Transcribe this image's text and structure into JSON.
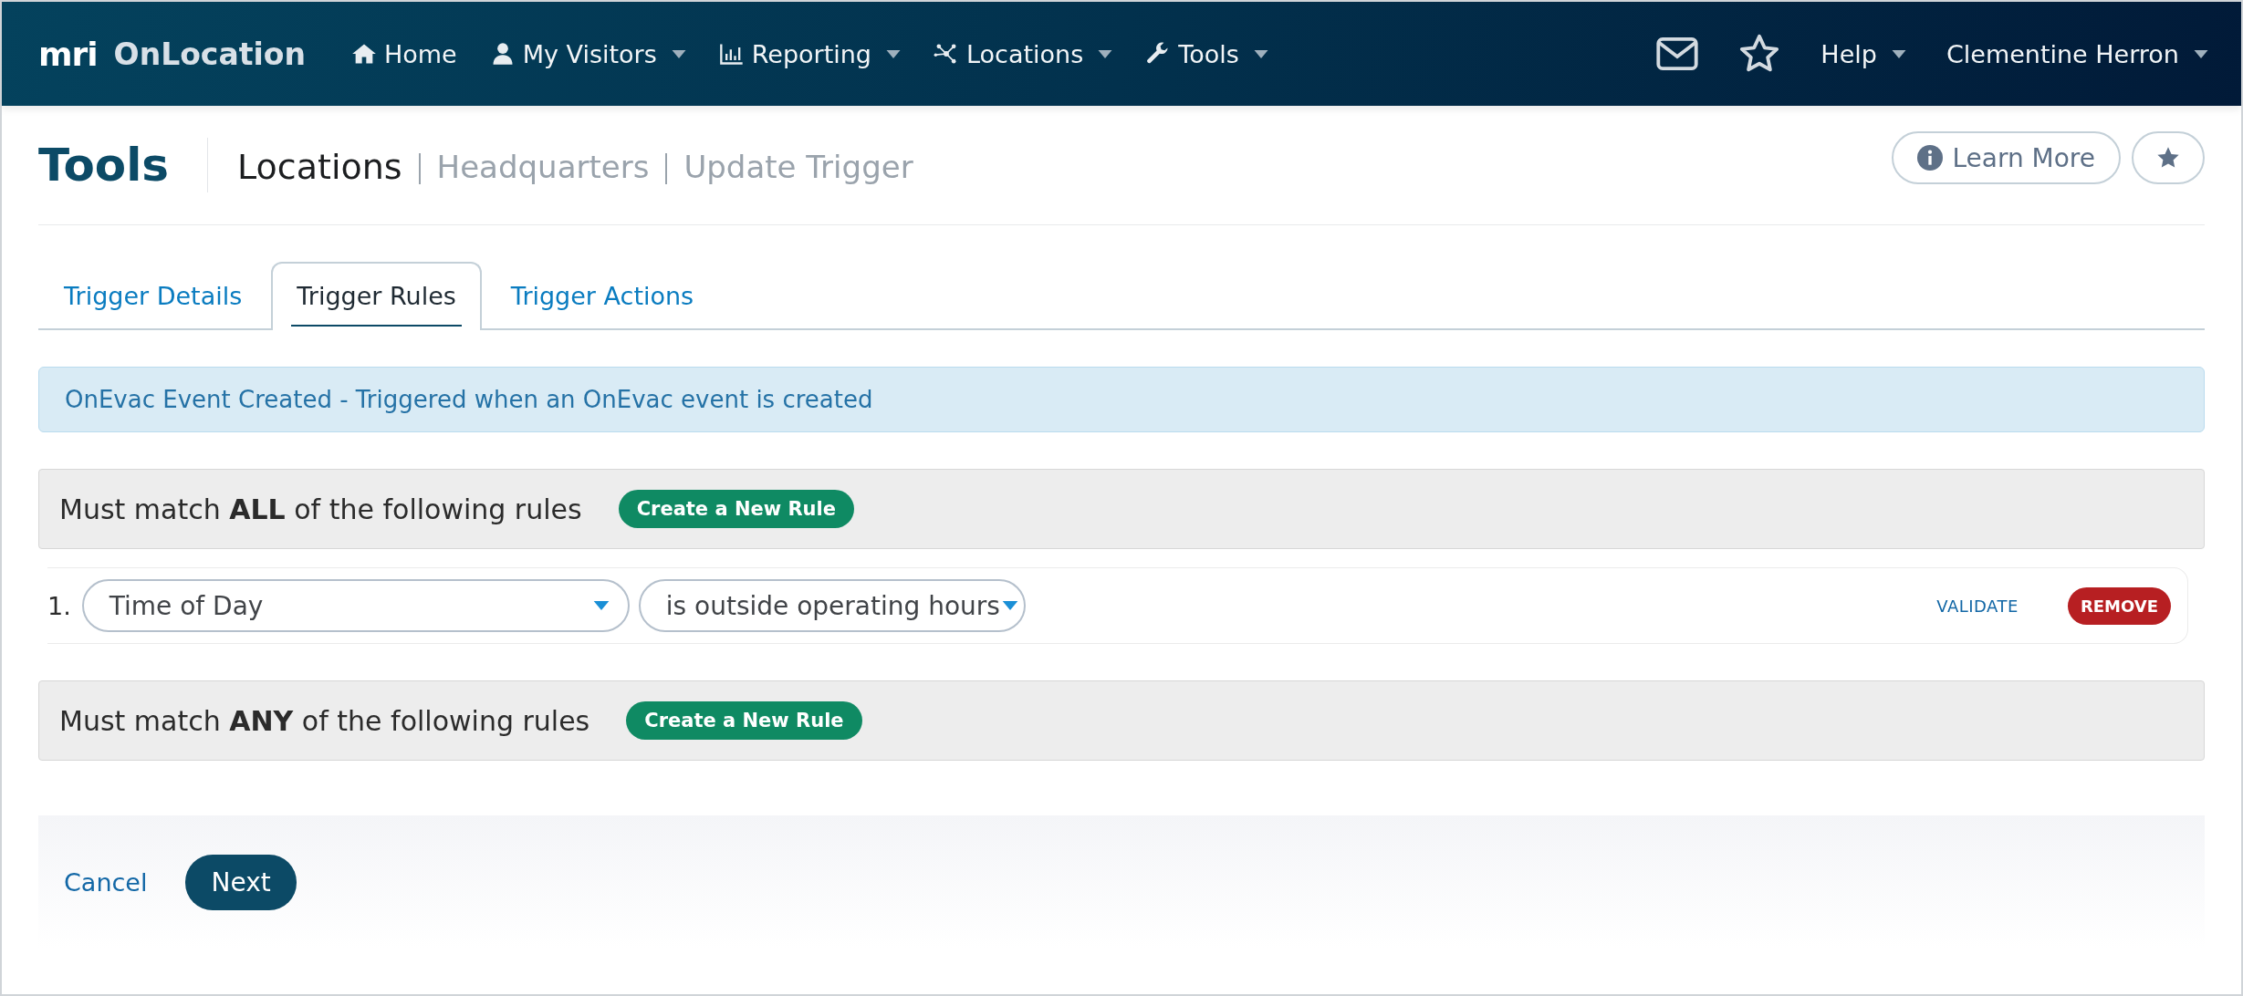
{
  "brand": {
    "logo": "mri",
    "name": "OnLocation"
  },
  "nav": [
    {
      "label": "Home",
      "dropdown": false
    },
    {
      "label": "My Visitors",
      "dropdown": true
    },
    {
      "label": "Reporting",
      "dropdown": true
    },
    {
      "label": "Locations",
      "dropdown": true
    },
    {
      "label": "Tools",
      "dropdown": true
    }
  ],
  "nav_right": {
    "help": "Help",
    "user": "Clementine Herron"
  },
  "page": {
    "title": "Tools",
    "breadcrumb": [
      "Locations",
      "Headquarters",
      "Update Trigger"
    ],
    "learn_more": "Learn More"
  },
  "tabs": [
    {
      "label": "Trigger Details",
      "selected": false
    },
    {
      "label": "Trigger Rules",
      "selected": true
    },
    {
      "label": "Trigger Actions",
      "selected": false
    }
  ],
  "alert": "OnEvac Event Created - Triggered when an OnEvac event is created",
  "rule_groups": [
    {
      "label": "Must match **ALL** of the following rules",
      "button": "Create a New Rule",
      "rules": [
        {
          "number": "1.",
          "field": "Time of Day",
          "condition": "is outside operating hours",
          "validate": "VALIDATE",
          "remove": "REMOVE"
        }
      ]
    },
    {
      "label": "Must match **ANY** of the following rules",
      "button": "Create a New Rule"
    }
  ],
  "footer": {
    "cancel": "Cancel",
    "next": "Next"
  }
}
